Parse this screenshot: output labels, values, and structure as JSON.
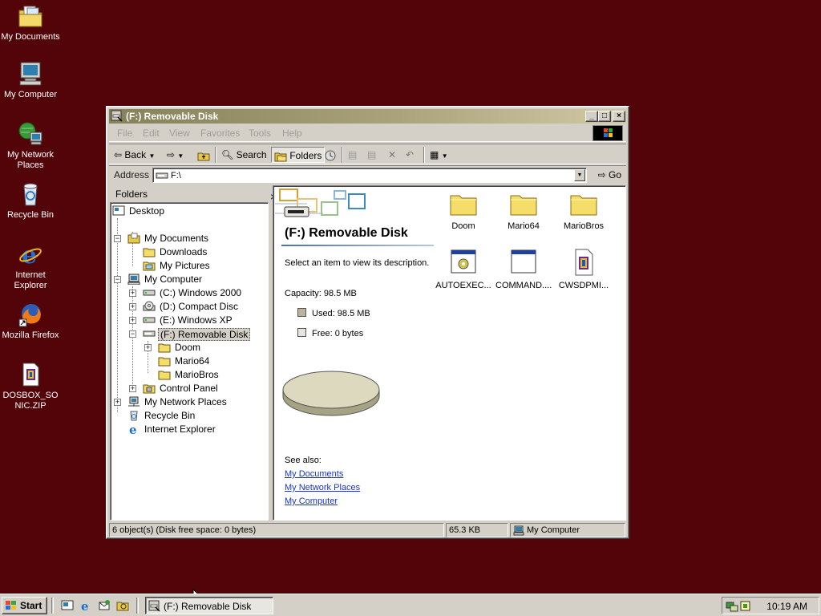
{
  "desktop": {
    "icons": [
      {
        "label": "My Documents"
      },
      {
        "label": "My Computer"
      },
      {
        "label_line1": "My Network",
        "label_line2": "Places"
      },
      {
        "label": "Recycle Bin"
      },
      {
        "label_line1": "Internet",
        "label_line2": "Explorer"
      },
      {
        "label": "Mozilla Firefox"
      },
      {
        "label_line1": "DOSBOX_SO",
        "label_line2": "NIC.ZIP"
      }
    ]
  },
  "window": {
    "title": "(F:) Removable Disk",
    "controls": {
      "minimize": "_",
      "maximize": "□",
      "close": "×"
    },
    "menu": [
      "File",
      "Edit",
      "View",
      "Favorites",
      "Tools",
      "Help"
    ],
    "toolbar": {
      "back": "Back",
      "search": "Search",
      "folders": "Folders"
    },
    "address": {
      "label": "Address",
      "value": "F:\\",
      "go": "Go"
    },
    "folders_pane": {
      "title": "Folders",
      "close": "×",
      "tree": [
        "Desktop",
        "My Documents",
        "Downloads",
        "My Pictures",
        "My Computer",
        "(C:) Windows 2000",
        "(D:) Compact Disc",
        "(E:) Windows XP",
        "(F:) Removable Disk",
        "Doom",
        "Mario64",
        "MarioBros",
        "Control Panel",
        "My Network Places",
        "Recycle Bin",
        "Internet Explorer"
      ]
    },
    "content": {
      "heading": "(F:) Removable Disk",
      "description": "Select an item to view its description.",
      "capacity": "Capacity: 98.5 MB",
      "used": "Used: 98.5 MB",
      "free": "Free: 0 bytes",
      "used_fraction": 1.0,
      "see_also": "See also:",
      "links": [
        "My Documents",
        "My Network Places",
        "My Computer"
      ],
      "files": [
        {
          "name": "Doom",
          "icon": "folder-icon"
        },
        {
          "name": "Mario64",
          "icon": "folder-icon"
        },
        {
          "name": "MarioBros",
          "icon": "folder-icon"
        },
        {
          "name": "AUTOEXEC...",
          "icon": "system-file-icon"
        },
        {
          "name": "COMMAND....",
          "icon": "application-icon"
        },
        {
          "name": "CWSDPMI...",
          "icon": "executable-icon"
        }
      ]
    },
    "status": {
      "objects": "6 object(s) (Disk free space: 0 bytes)",
      "size": "65.3 KB",
      "zone": "My Computer"
    }
  },
  "taskbar": {
    "start": "Start",
    "task": "(F:) Removable Disk",
    "clock": "10:19 AM"
  },
  "colors": {
    "desktop": "#520409",
    "face": "#d4d0c8",
    "link": "#1a35c4",
    "pie": "#dcd9be"
  }
}
